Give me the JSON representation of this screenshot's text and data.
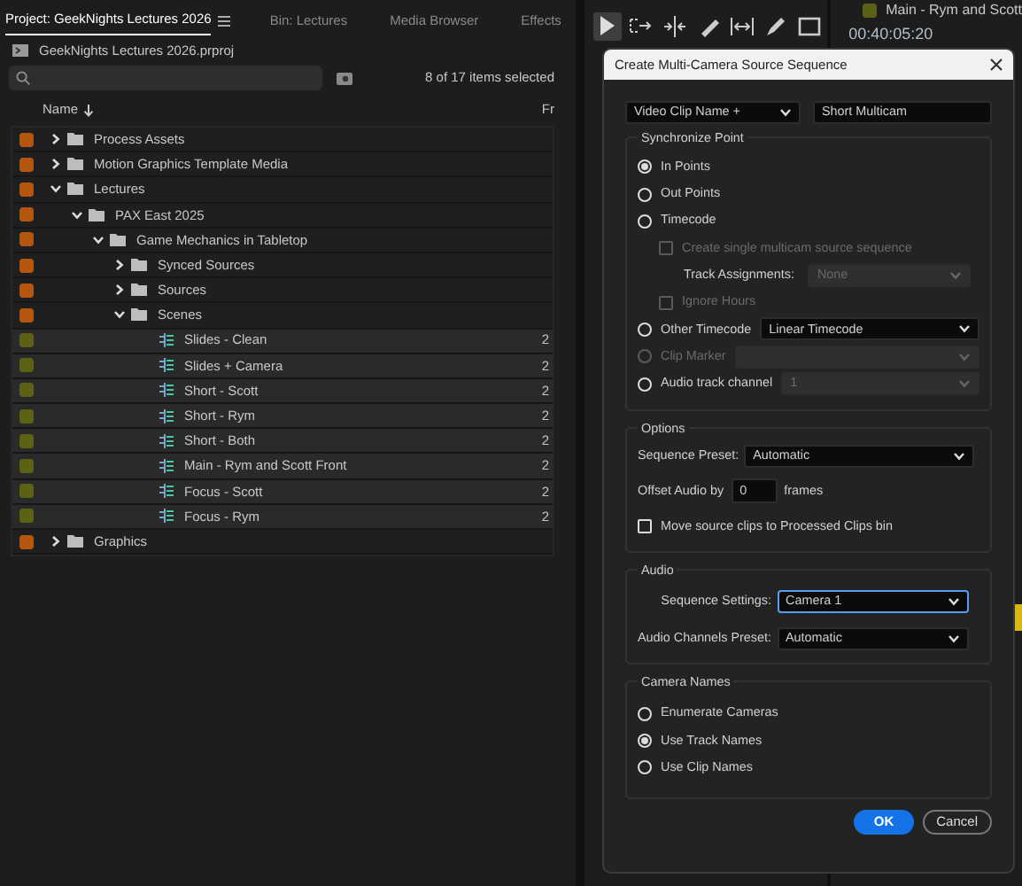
{
  "panel_tabs": [
    {
      "label": "Project: GeekNights Lectures 2026",
      "selected": true
    },
    {
      "label": "Bin: Lectures",
      "selected": false
    },
    {
      "label": "Media Browser",
      "selected": false
    },
    {
      "label": "Effects",
      "selected": false
    }
  ],
  "project_file": "GeekNights Lectures 2026.prproj",
  "selection_count": "8 of 17 items selected",
  "columns": [
    "Name",
    "Fr"
  ],
  "tree": [
    {
      "kind": "folder",
      "name": "Process Assets",
      "color": "#b4560f",
      "expanded": false
    },
    {
      "kind": "folder",
      "name": "Motion Graphics Template Media",
      "color": "#b4560f",
      "expanded": false
    },
    {
      "kind": "folder",
      "name": "Lectures",
      "color": "#b4560f",
      "expanded": true,
      "children": [
        {
          "kind": "folder",
          "name": "PAX East 2025",
          "color": "#b4560f",
          "expanded": true,
          "children": [
            {
              "kind": "folder",
              "name": "Game Mechanics in Tabletop",
              "color": "#b4560f",
              "expanded": true,
              "children": [
                {
                  "kind": "folder",
                  "name": "Synced Sources",
                  "color": "#b4560f",
                  "expanded": false
                },
                {
                  "kind": "folder",
                  "name": "Sources",
                  "color": "#b4560f",
                  "expanded": false
                },
                {
                  "kind": "folder",
                  "name": "Scenes",
                  "color": "#b4560f",
                  "expanded": true,
                  "children": [
                    {
                      "kind": "clip",
                      "name": "Slides - Clean",
                      "color": "#5b6115",
                      "column_2": "2"
                    },
                    {
                      "kind": "clip",
                      "name": "Slides + Camera",
                      "color": "#5b6115",
                      "column_2": "2"
                    },
                    {
                      "kind": "clip",
                      "name": "Short - Scott",
                      "color": "#5b6115",
                      "column_2": "2"
                    },
                    {
                      "kind": "clip",
                      "name": "Short - Rym",
                      "color": "#5b6115",
                      "column_2": "2"
                    },
                    {
                      "kind": "clip",
                      "name": "Short - Both",
                      "color": "#5b6115",
                      "column_2": "2"
                    },
                    {
                      "kind": "clip",
                      "name": "Main - Rym and Scott Front",
                      "color": "#5b6115",
                      "column_2": "2"
                    },
                    {
                      "kind": "clip",
                      "name": "Focus - Scott",
                      "color": "#5b6115",
                      "column_2": "2"
                    },
                    {
                      "kind": "clip",
                      "name": "Focus - Rym",
                      "color": "#5b6115",
                      "column_2": "2"
                    }
                  ]
                }
              ]
            }
          ]
        }
      ]
    },
    {
      "kind": "folder",
      "name": "Graphics",
      "color": "#b4560f",
      "expanded": false
    }
  ],
  "tools": [
    {
      "kind": "selection",
      "selected": true
    },
    {
      "kind": "track-select",
      "selected": false
    },
    {
      "kind": "ripple",
      "selected": false
    },
    {
      "kind": "razor",
      "selected": false
    },
    {
      "kind": "slip",
      "selected": false
    },
    {
      "kind": "pen",
      "selected": false
    },
    {
      "kind": "rectangle",
      "selected": false
    }
  ],
  "source_monitor": {
    "clip_name": "Main - Rym and Scott",
    "color": "#5b6115",
    "timecode": "00:40:05:20"
  },
  "dialog": {
    "title": "Create Multi-Camera Source Sequence",
    "name_preset": "Video Clip Name +",
    "name_value": "Short Multicam",
    "sync": {
      "legend": "Synchronize Point",
      "options": [
        {
          "label": "In Points",
          "selected": true,
          "disabled": false
        },
        {
          "label": "Out Points",
          "selected": false,
          "disabled": false
        },
        {
          "label": "Timecode",
          "selected": false,
          "disabled": false,
          "children": [
            {
              "kind": "checkbox",
              "label": "Create single multicam source sequence",
              "checked": false,
              "disabled": true
            },
            {
              "kind": "select",
              "label": "Track Assignments:",
              "value": "None",
              "disabled": true
            },
            {
              "kind": "checkbox",
              "label": "Ignore Hours",
              "checked": false,
              "disabled": true
            }
          ]
        },
        {
          "label": "Other Timecode",
          "selected": false,
          "disabled": false,
          "select": {
            "value": "Linear Timecode",
            "disabled": false
          }
        },
        {
          "label": "Clip Marker",
          "selected": false,
          "disabled": true,
          "select": {
            "disabled": true
          }
        },
        {
          "label": "Audio track channel",
          "selected": false,
          "disabled": false,
          "select": {
            "value": "1",
            "disabled": true
          }
        }
      ]
    },
    "options": {
      "legend": "Options",
      "sequence_preset": {
        "label": "Sequence Preset:",
        "value": "Automatic"
      },
      "offset_audio": {
        "label": "Offset Audio by",
        "value": "0",
        "unit": "frames"
      },
      "move_clips": {
        "label": "Move source clips to Processed Clips bin",
        "checked": false
      }
    },
    "audio": {
      "legend": "Audio",
      "fields": [
        {
          "label": "Sequence Settings:",
          "value": "Camera 1",
          "focused": true
        },
        {
          "label": "Audio Channels Preset:",
          "value": "Automatic",
          "focused": false
        }
      ]
    },
    "camera_names": {
      "legend": "Camera Names",
      "options": [
        {
          "label": "Enumerate Cameras",
          "selected": false
        },
        {
          "label": "Use Track Names",
          "selected": true
        },
        {
          "label": "Use Clip Names",
          "selected": false
        }
      ]
    },
    "buttons": [
      {
        "label": "OK",
        "kind": "primary"
      },
      {
        "label": "Cancel",
        "kind": "secondary"
      }
    ]
  }
}
